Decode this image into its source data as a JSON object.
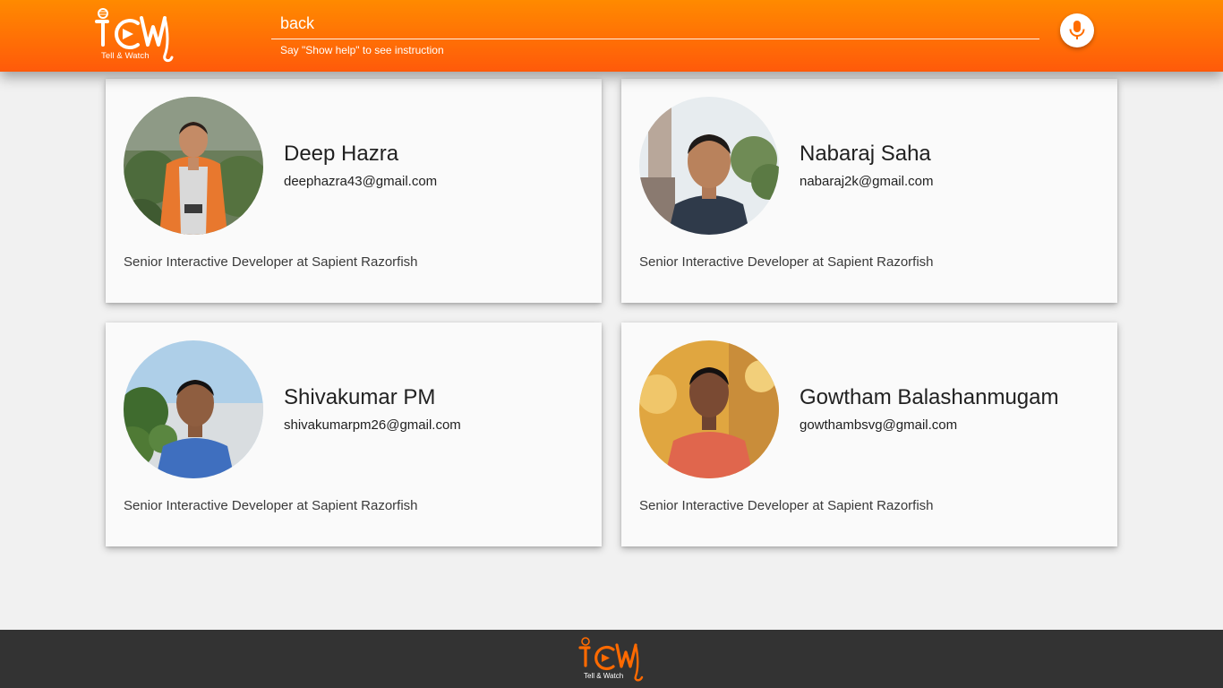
{
  "header": {
    "brand_tagline": "Tell & Watch",
    "search": {
      "value": "back",
      "hint": "Say \"Show help\" to see instruction"
    },
    "mic_icon": "microphone-icon"
  },
  "team": [
    {
      "name": "Deep Hazra",
      "email": "deephazra43@gmail.com",
      "role": "Senior Interactive Developer at Sapient Razorfish"
    },
    {
      "name": "Nabaraj Saha",
      "email": "nabaraj2k@gmail.com",
      "role": "Senior Interactive Developer at Sapient Razorfish"
    },
    {
      "name": "Shivakumar PM",
      "email": "shivakumarpm26@gmail.com",
      "role": "Senior Interactive Developer at Sapient Razorfish"
    },
    {
      "name": "Gowtham Balashanmugam",
      "email": "gowthambsvg@gmail.com",
      "role": "Senior Interactive Developer at Sapient Razorfish"
    }
  ],
  "footer": {
    "brand_tagline": "Tell & Watch"
  },
  "colors": {
    "header_top": "#ff8a00",
    "header_bottom": "#ff5a0a",
    "mic_accent": "#ff6d00",
    "page_bg": "#f1f1f1",
    "footer_bg": "#333333"
  }
}
